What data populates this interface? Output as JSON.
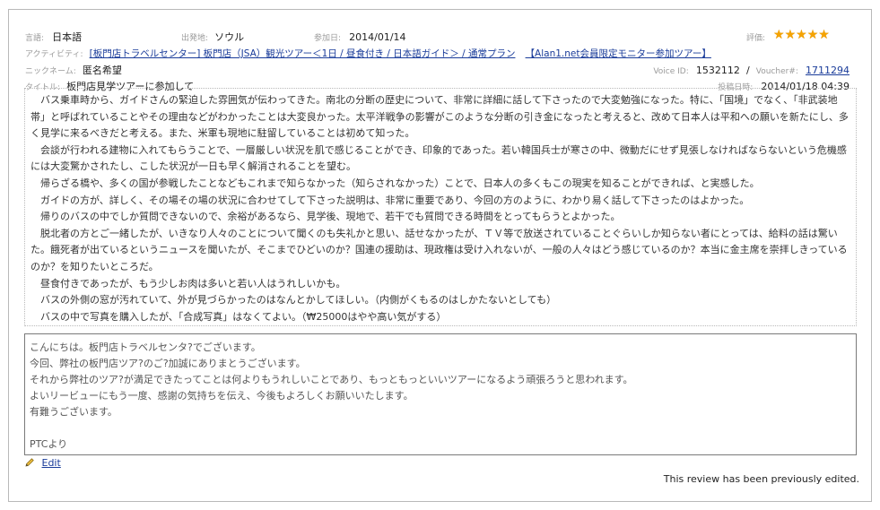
{
  "meta": {
    "language_label": "言語:",
    "language_value": "日本語",
    "departure_label": "出発地:",
    "departure_value": "ソウル",
    "date_label": "参加日:",
    "date_value": "2014/01/14",
    "rating_label": "評価:",
    "rating_stars": 5,
    "activity_label": "アクティビティ:",
    "activity_link": "[板門店トラベルセンター] 板門店（JSA）観光ツアー＜1日 / 昼食付き / 日本語ガイド＞ / 通常プラン",
    "activity_campaign": "【Alan1.net会員限定モニター参加ツアー】",
    "nickname_label": "ニックネーム:",
    "nickname_value": "匿名希望",
    "voice_id_label": "Voice ID:",
    "voice_id_value": "1532112",
    "separator": "/",
    "voucher_label": "Voucher#:",
    "voucher_value": "1711294",
    "title_label": "タイトル:",
    "title_value": "板門店見学ツアーに参加して",
    "posted_label": "投稿日時:",
    "posted_value": "2014/01/18 04:39"
  },
  "review": {
    "paragraphs": [
      "バス乗車時から、ガイドさんの緊迫した雰囲気が伝わってきた。南北の分断の歴史について、非常に詳細に話して下さったので大変勉強になった。特に、「国境」でなく、「非武装地帯」と呼ばれていることやその理由などがわかったことは大変良かった。太平洋戦争の影響がこのような分断の引き金になったと考えると、改めて日本人は平和への願いを新たにし、多く見学に来るべきだと考える。また、米軍も現地に駐留していることは初めて知った。",
      "会談が行われる建物に入れてもらうことで、一層厳しい状況を肌で感じることができ、印象的であった。若い韓国兵士が寒さの中、微動だにせず見張しなければならないという危機感には大変驚かされたし、こした状況が一日も早く解消されることを望む。",
      "帰らざる橋や、多くの国が参戦したことなどもこれまで知らなかった（知らされなかった）ことで、日本人の多くもこの現実を知ることができれば、と実感した。",
      "ガイドの方が、詳しく、その場その場の状況に合わせてして下さった説明は、非常に重要であり、今回の方のように、わかり易く話して下さったのはよかった。",
      "帰りのバスの中でしか質問できないので、余裕があるなら、見学後、現地で、若干でも質問できる時間をとってもらうとよかった。",
      "脱北者の方とご一緒したが、いきなり人々のことについて聞くのも失礼かと思い、話せなかったが、ＴＶ等で放送されていることぐらいしか知らない者にとっては、給料の話は驚いた。餓死者が出ているというニュースを聞いたが、そこまでひどいのか？国連の援助は、現政権は受け入れないが、一般の人々はどう感じているのか？本当に金主席を崇拝しきっているのか？を知りたいところだ。",
      "昼食付きであったが、もう少しお肉は多いと若い人はうれしいかも。",
      "バスの外側の窓が汚れていて、外が見づらかったのはなんとかしてほしい。（内側がくもるのはしかたないとしても）",
      "バスの中で写真を購入したが、「合成写真」はなくてよい。（₩25000はやや高い気がする）"
    ]
  },
  "reply": {
    "lines": [
      "こんにちは。板門店トラベルセンタ?でございます。",
      "今回、弊社の板門店ツア?のご?加誠にありまとうございます。",
      "それから弊社のツア?が満足できたってことは何よりもうれしいことであり、もっともっといいツアーになるよう頑張ろうと思われます。",
      "よいリービューにもう一度、感謝の気持ちを伝え、今後もよろしくお願いいたします。",
      "有難うございます。",
      "",
      "PTCより"
    ]
  },
  "actions": {
    "edit_label": "Edit",
    "edited_notice": "This review has been previously edited."
  },
  "colors": {
    "star": "#f5a300",
    "link": "#1a3c9a",
    "label_gray": "#9a9a9a"
  }
}
